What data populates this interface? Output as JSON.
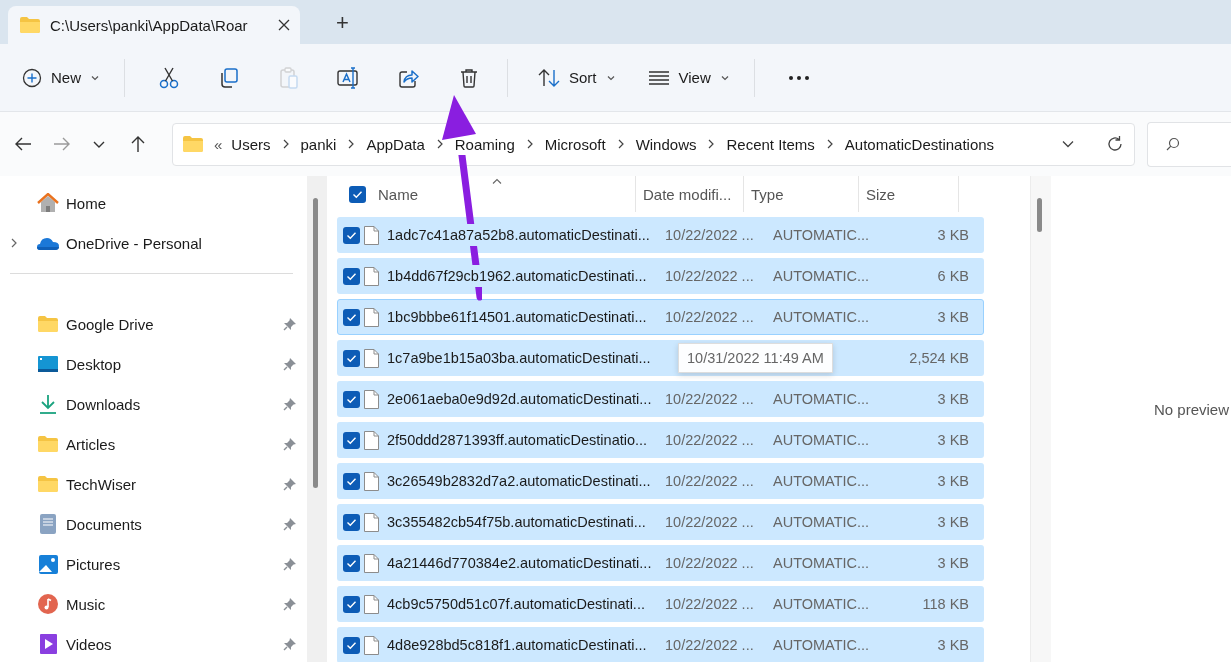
{
  "tab": {
    "title": "C:\\Users\\panki\\AppData\\Roar",
    "new_tab": "+"
  },
  "toolbar": [
    {
      "kind": "new",
      "label": "New",
      "disabled": false
    },
    {
      "kind": "cut",
      "disabled": false
    },
    {
      "kind": "copy",
      "disabled": false
    },
    {
      "kind": "paste",
      "disabled": true
    },
    {
      "kind": "rename",
      "disabled": false
    },
    {
      "kind": "share",
      "disabled": false
    },
    {
      "kind": "delete",
      "disabled": false
    },
    {
      "kind": "sort",
      "label": "Sort",
      "disabled": false
    },
    {
      "kind": "view",
      "label": "View",
      "disabled": false
    },
    {
      "kind": "more",
      "disabled": false
    }
  ],
  "nav": [
    {
      "kind": "back",
      "disabled": false
    },
    {
      "kind": "forward",
      "disabled": true
    },
    {
      "kind": "recent",
      "disabled": false
    },
    {
      "kind": "up",
      "disabled": false
    }
  ],
  "address": {
    "overflow": "«",
    "crumbs": [
      "Users",
      "panki",
      "AppData",
      "Roaming",
      "Microsoft",
      "Windows",
      "Recent Items",
      "AutomaticDestinations"
    ]
  },
  "sidebar": {
    "top": [
      {
        "label": "Home",
        "kind": "home",
        "expandable": false
      },
      {
        "label": "OneDrive - Personal",
        "kind": "cloud",
        "expandable": true
      }
    ],
    "pinned": [
      {
        "label": "Google Drive",
        "kind": "folder",
        "pinned": true
      },
      {
        "label": "Desktop",
        "kind": "desktop",
        "pinned": true
      },
      {
        "label": "Downloads",
        "kind": "download",
        "pinned": true
      },
      {
        "label": "Articles",
        "kind": "folder",
        "pinned": true
      },
      {
        "label": "TechWiser",
        "kind": "folder",
        "pinned": true
      },
      {
        "label": "Documents",
        "kind": "document",
        "pinned": true
      },
      {
        "label": "Pictures",
        "kind": "pictures",
        "pinned": true
      },
      {
        "label": "Music",
        "kind": "music",
        "pinned": true
      },
      {
        "label": "Videos",
        "kind": "videos",
        "pinned": true
      }
    ]
  },
  "table": {
    "all_checked": true,
    "columns": [
      {
        "label": "Name",
        "sorted": true
      },
      {
        "label": "Date modifi...",
        "sorted": false
      },
      {
        "label": "Type",
        "sorted": false
      },
      {
        "label": "Size",
        "sorted": false
      }
    ],
    "rows": [
      {
        "name": "1adc7c41a87a52b8.automaticDestinati...",
        "date": "10/22/2022 ...",
        "type": "AUTOMATIC...",
        "size": "3 KB",
        "checked": true,
        "focused": false
      },
      {
        "name": "1b4dd67f29cb1962.automaticDestinati...",
        "date": "10/22/2022 ...",
        "type": "AUTOMATIC...",
        "size": "6 KB",
        "checked": true,
        "focused": false
      },
      {
        "name": "1bc9bbbe61f14501.automaticDestinati...",
        "date": "10/22/2022 ...",
        "type": "AUTOMATIC...",
        "size": "3 KB",
        "checked": true,
        "focused": true
      },
      {
        "name": "1c7a9be1b15a03ba.automaticDestinati...",
        "size": "2,524 KB",
        "checked": true,
        "focused": false
      },
      {
        "name": "2e061aeba0e9d92d.automaticDestinati...",
        "date": "10/22/2022 ...",
        "type": "AUTOMATIC...",
        "size": "3 KB",
        "checked": true,
        "focused": false
      },
      {
        "name": "2f50ddd2871393ff.automaticDestinatio...",
        "date": "10/22/2022 ...",
        "type": "AUTOMATIC...",
        "size": "3 KB",
        "checked": true,
        "focused": false
      },
      {
        "name": "3c26549b2832d7a2.automaticDestinati...",
        "date": "10/22/2022 ...",
        "type": "AUTOMATIC...",
        "size": "3 KB",
        "checked": true,
        "focused": false
      },
      {
        "name": "3c355482cb54f75b.automaticDestinati...",
        "date": "10/22/2022 ...",
        "type": "AUTOMATIC...",
        "size": "3 KB",
        "checked": true,
        "focused": false
      },
      {
        "name": "4a21446d770384e2.automaticDestinati...",
        "date": "10/22/2022 ...",
        "type": "AUTOMATIC...",
        "size": "3 KB",
        "checked": true,
        "focused": false
      },
      {
        "name": "4cb9c5750d51c07f.automaticDestinati...",
        "date": "10/22/2022 ...",
        "type": "AUTOMATIC...",
        "size": "118 KB",
        "checked": true,
        "focused": false
      },
      {
        "name": "4d8e928bd5c818f1.automaticDestinati...",
        "date": "10/22/2022 ...",
        "type": "AUTOMATIC...",
        "size": "3 KB",
        "checked": true,
        "focused": false
      }
    ],
    "tooltip": "10/31/2022 11:49 AM"
  },
  "preview": {
    "message": "No preview"
  }
}
